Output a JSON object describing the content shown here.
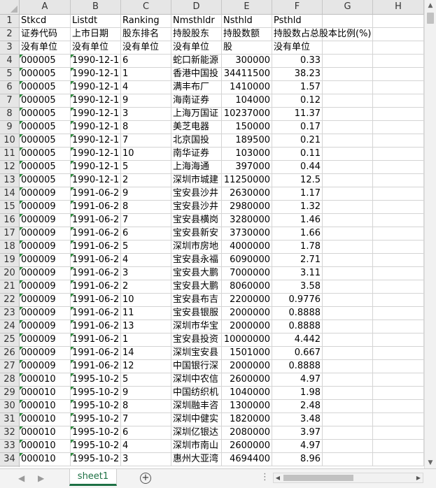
{
  "columns": [
    "A",
    "B",
    "C",
    "D",
    "E",
    "F",
    "G",
    "H"
  ],
  "rows": [
    {
      "n": "1",
      "cells": [
        "Stkcd",
        "Listdt",
        "Ranking",
        "Nmsthldr",
        "Nsthld",
        "Psthld",
        "",
        ""
      ]
    },
    {
      "n": "2",
      "cells": [
        "证券代码",
        "上市日期",
        "股东排名",
        "持股股东",
        "持股数额",
        "持股数占总股本比例(%)",
        "",
        ""
      ]
    },
    {
      "n": "3",
      "cells": [
        "没有单位",
        "没有单位",
        "没有单位",
        "没有单位",
        "股",
        "没有单位",
        "",
        ""
      ]
    },
    {
      "n": "4",
      "cells": [
        "000005",
        "1990-12-1",
        "6",
        "蛇口新能源",
        "300000",
        "0.33",
        "",
        ""
      ]
    },
    {
      "n": "5",
      "cells": [
        "000005",
        "1990-12-1",
        "1",
        "香港中国投",
        "34411500",
        "38.23",
        "",
        ""
      ]
    },
    {
      "n": "6",
      "cells": [
        "000005",
        "1990-12-1",
        "4",
        "满丰布厂",
        "1410000",
        "1.57",
        "",
        ""
      ]
    },
    {
      "n": "7",
      "cells": [
        "000005",
        "1990-12-1",
        "9",
        "海南证券",
        "104000",
        "0.12",
        "",
        ""
      ]
    },
    {
      "n": "8",
      "cells": [
        "000005",
        "1990-12-1",
        "3",
        "上海万国证",
        "10237000",
        "11.37",
        "",
        ""
      ]
    },
    {
      "n": "9",
      "cells": [
        "000005",
        "1990-12-1",
        "8",
        "美芝电器",
        "150000",
        "0.17",
        "",
        ""
      ]
    },
    {
      "n": "10",
      "cells": [
        "000005",
        "1990-12-1",
        "7",
        "北京国投",
        "189500",
        "0.21",
        "",
        ""
      ]
    },
    {
      "n": "11",
      "cells": [
        "000005",
        "1990-12-1",
        "10",
        "南华证券",
        "103000",
        "0.11",
        "",
        ""
      ]
    },
    {
      "n": "12",
      "cells": [
        "000005",
        "1990-12-1",
        "5",
        "上海海通",
        "397000",
        "0.44",
        "",
        ""
      ]
    },
    {
      "n": "13",
      "cells": [
        "000005",
        "1990-12-1",
        "2",
        "深圳市城建",
        "11250000",
        "12.5",
        "",
        ""
      ]
    },
    {
      "n": "14",
      "cells": [
        "000009",
        "1991-06-2",
        "9",
        "宝安县沙井",
        "2630000",
        "1.17",
        "",
        ""
      ]
    },
    {
      "n": "15",
      "cells": [
        "000009",
        "1991-06-2",
        "8",
        "宝安县沙井",
        "2980000",
        "1.32",
        "",
        ""
      ]
    },
    {
      "n": "16",
      "cells": [
        "000009",
        "1991-06-2",
        "7",
        "宝安县横岗",
        "3280000",
        "1.46",
        "",
        ""
      ]
    },
    {
      "n": "17",
      "cells": [
        "000009",
        "1991-06-2",
        "6",
        "宝安县新安",
        "3730000",
        "1.66",
        "",
        ""
      ]
    },
    {
      "n": "18",
      "cells": [
        "000009",
        "1991-06-2",
        "5",
        "深圳市房地",
        "4000000",
        "1.78",
        "",
        ""
      ]
    },
    {
      "n": "19",
      "cells": [
        "000009",
        "1991-06-2",
        "4",
        "宝安县永福",
        "6090000",
        "2.71",
        "",
        ""
      ]
    },
    {
      "n": "20",
      "cells": [
        "000009",
        "1991-06-2",
        "3",
        "宝安县大鹏",
        "7000000",
        "3.11",
        "",
        ""
      ]
    },
    {
      "n": "21",
      "cells": [
        "000009",
        "1991-06-2",
        "2",
        "宝安县大鹏",
        "8060000",
        "3.58",
        "",
        ""
      ]
    },
    {
      "n": "22",
      "cells": [
        "000009",
        "1991-06-2",
        "10",
        "宝安县布吉",
        "2200000",
        "0.9776",
        "",
        ""
      ]
    },
    {
      "n": "23",
      "cells": [
        "000009",
        "1991-06-2",
        "11",
        "宝安县银服",
        "2000000",
        "0.8888",
        "",
        ""
      ]
    },
    {
      "n": "24",
      "cells": [
        "000009",
        "1991-06-2",
        "13",
        "深圳市华宝",
        "2000000",
        "0.8888",
        "",
        ""
      ]
    },
    {
      "n": "25",
      "cells": [
        "000009",
        "1991-06-2",
        "1",
        "宝安县投资",
        "10000000",
        "4.442",
        "",
        ""
      ]
    },
    {
      "n": "26",
      "cells": [
        "000009",
        "1991-06-2",
        "14",
        "深圳宝安县",
        "1501000",
        "0.667",
        "",
        ""
      ]
    },
    {
      "n": "27",
      "cells": [
        "000009",
        "1991-06-2",
        "12",
        "中国银行深",
        "2000000",
        "0.8888",
        "",
        ""
      ]
    },
    {
      "n": "28",
      "cells": [
        "000010",
        "1995-10-2",
        "5",
        "深圳中农信",
        "2600000",
        "4.97",
        "",
        ""
      ]
    },
    {
      "n": "29",
      "cells": [
        "000010",
        "1995-10-2",
        "9",
        "中国纺织机",
        "1040000",
        "1.98",
        "",
        ""
      ]
    },
    {
      "n": "30",
      "cells": [
        "000010",
        "1995-10-2",
        "8",
        "深圳融丰咨",
        "1300000",
        "2.48",
        "",
        ""
      ]
    },
    {
      "n": "31",
      "cells": [
        "000010",
        "1995-10-2",
        "7",
        "深圳中健实",
        "1820000",
        "3.48",
        "",
        ""
      ]
    },
    {
      "n": "32",
      "cells": [
        "000010",
        "1995-10-2",
        "6",
        "深圳亿银达",
        "2080000",
        "3.97",
        "",
        ""
      ]
    },
    {
      "n": "33",
      "cells": [
        "000010",
        "1995-10-2",
        "4",
        "深圳市南山",
        "2600000",
        "4.97",
        "",
        ""
      ]
    },
    {
      "n": "34",
      "cells": [
        "000010",
        "1995-10-2",
        "3",
        "惠州大亚湾",
        "4694400",
        "8.96",
        "",
        ""
      ]
    }
  ],
  "sheet_tab": "sheet1",
  "add_sheet_symbol": "+",
  "scroll_more": "⋮",
  "nav_prev": "◀",
  "nav_next": "▶",
  "scroll_up": "▲",
  "scroll_down": "▼",
  "scroll_left": "◀",
  "scroll_right": "▶",
  "colors": {
    "tab_accent": "#1e7145",
    "error_tag": "#2a8a3a"
  }
}
